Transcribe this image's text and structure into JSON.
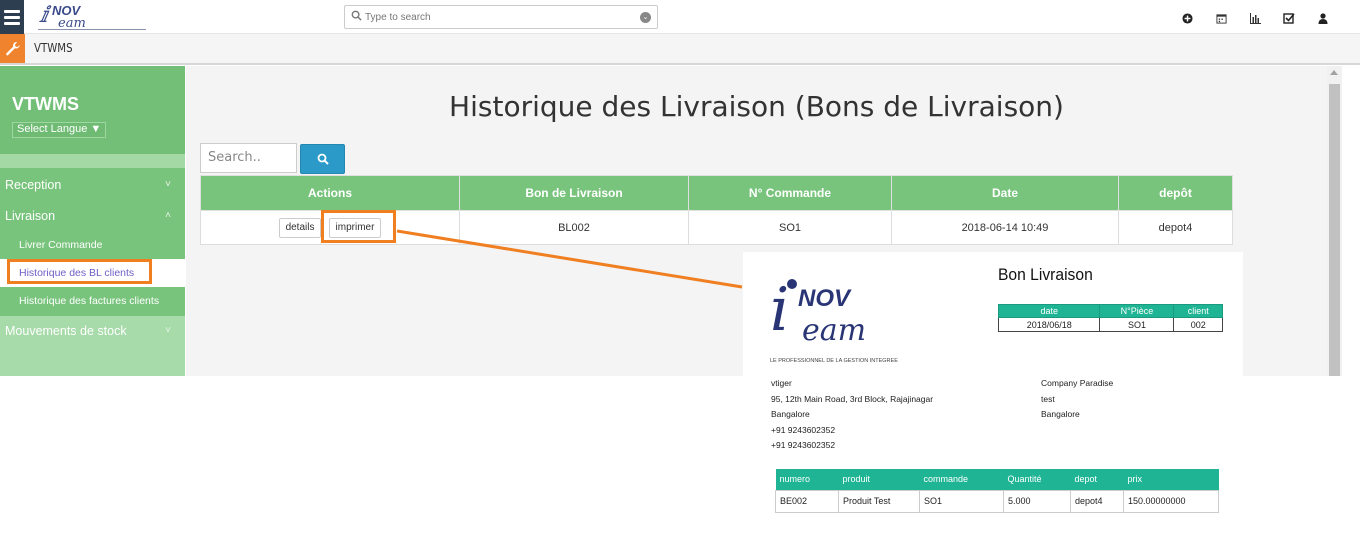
{
  "app": {
    "breadcrumb": "VTWMS",
    "search_placeholder": "Type to search",
    "logo_text": "INOV TEAM"
  },
  "topbar_icons": [
    "plus-circle-icon",
    "calendar-icon",
    "bar-chart-icon",
    "checkbox-icon",
    "user-icon"
  ],
  "sidebar": {
    "title": "VTWMS",
    "lang_label": "Select Langue ▼",
    "items": [
      {
        "label": "Reception",
        "chevron": "˅"
      },
      {
        "label": "Livraison",
        "chevron": "˄"
      },
      {
        "label": "Mouvements de stock",
        "chevron": "˅"
      }
    ],
    "subitems": [
      {
        "label": "Livrer Commande"
      },
      {
        "label": "Historique des BL clients"
      },
      {
        "label": "Historique des factures clients"
      }
    ]
  },
  "main": {
    "title": "Historique des Livraison (Bons de Livraison)",
    "search_placeholder": "Search..",
    "columns": [
      "Actions",
      "Bon de Livraison",
      "N° Commande",
      "Date",
      "depôt"
    ],
    "rows": [
      {
        "bl": "BL002",
        "commande": "SO1",
        "date": "2018-06-14 10:49",
        "depot": "depot4"
      }
    ],
    "details_label": "details",
    "print_label": "imprimer"
  },
  "preview": {
    "title": "Bon Livraison",
    "meta_headers": [
      "date",
      "N°Pièce",
      "client"
    ],
    "meta_values": [
      "2018/06/18",
      "SO1",
      "002"
    ],
    "sender": [
      "vtiger",
      "95, 12th Main Road, 3rd Block, Rajajinagar",
      "Bangalore",
      "+91 9243602352",
      "+91 9243602352"
    ],
    "receiver": [
      "Company Paradise",
      "test",
      "Bangalore"
    ],
    "item_headers": [
      "numero",
      "produit",
      "commande",
      "Quantité",
      "depot",
      "prix"
    ],
    "item_row": [
      "BE002",
      "Produit Test",
      "SO1",
      "5.000",
      "depot4",
      "150.00000000"
    ],
    "logo_tagline": "LE PROFESSIONNEL DE LA GESTION INTEGREE"
  },
  "colors": {
    "sidebar_green": "#79c47d",
    "highlight_orange": "#f07f22",
    "teal_header": "#1fb494",
    "search_button": "#2b9ac8"
  }
}
